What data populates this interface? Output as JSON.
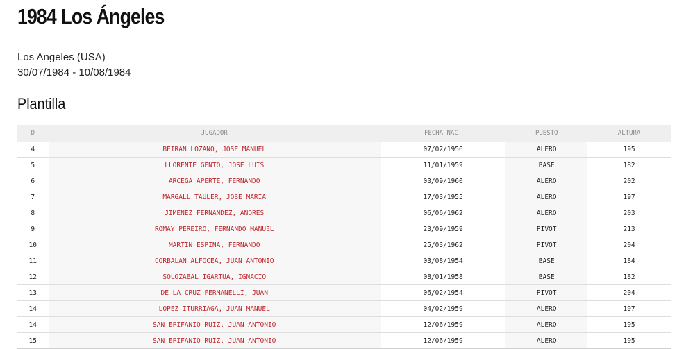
{
  "page": {
    "title": "1984 Los Ángeles",
    "location": "Los Angeles (USA)",
    "dates": "30/07/1984 - 10/08/1984",
    "section_title": "Plantilla"
  },
  "table": {
    "headers": {
      "d": "D",
      "player": "JUGADOR",
      "fecha": "FECHA NAC.",
      "puesto": "PUESTO",
      "altura": "ALTURA"
    },
    "rows": [
      {
        "d": "4",
        "player": "BEIRAN LOZANO, JOSE MANUEL",
        "fecha": "07/02/1956",
        "puesto": "ALERO",
        "altura": "195"
      },
      {
        "d": "5",
        "player": "LLORENTE GENTO, JOSE LUIS",
        "fecha": "11/01/1959",
        "puesto": "BASE",
        "altura": "182"
      },
      {
        "d": "6",
        "player": "ARCEGA APERTE, FERNANDO",
        "fecha": "03/09/1960",
        "puesto": "ALERO",
        "altura": "202"
      },
      {
        "d": "7",
        "player": "MARGALL TAULER, JOSE MARIA",
        "fecha": "17/03/1955",
        "puesto": "ALERO",
        "altura": "197"
      },
      {
        "d": "8",
        "player": "JIMENEZ FERNANDEZ, ANDRES",
        "fecha": "06/06/1962",
        "puesto": "ALERO",
        "altura": "203"
      },
      {
        "d": "9",
        "player": "ROMAY PEREIRO, FERNANDO MANUEL",
        "fecha": "23/09/1959",
        "puesto": "PIVOT",
        "altura": "213"
      },
      {
        "d": "10",
        "player": "MARTIN ESPINA, FERNANDO",
        "fecha": "25/03/1962",
        "puesto": "PIVOT",
        "altura": "204"
      },
      {
        "d": "11",
        "player": "CORBALAN ALFOCEA, JUAN ANTONIO",
        "fecha": "03/08/1954",
        "puesto": "BASE",
        "altura": "184"
      },
      {
        "d": "12",
        "player": "SOLOZABAL IGARTUA, IGNACIO",
        "fecha": "08/01/1958",
        "puesto": "BASE",
        "altura": "182"
      },
      {
        "d": "13",
        "player": "DE LA CRUZ FERMANELLI, JUAN",
        "fecha": "06/02/1954",
        "puesto": "PIVOT",
        "altura": "204"
      },
      {
        "d": "14",
        "player": "LOPEZ ITURRIAGA, JUAN MANUEL",
        "fecha": "04/02/1959",
        "puesto": "ALERO",
        "altura": "197"
      },
      {
        "d": "14",
        "player": "SAN EPIFANIO RUIZ, JUAN ANTONIO",
        "fecha": "12/06/1959",
        "puesto": "ALERO",
        "altura": "195"
      },
      {
        "d": "15",
        "player": "SAN EPIFANIO RUIZ, JUAN ANTONIO",
        "fecha": "12/06/1959",
        "puesto": "ALERO",
        "altura": "195"
      }
    ]
  }
}
